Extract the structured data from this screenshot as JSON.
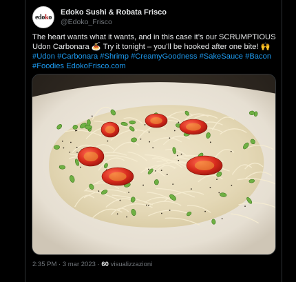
{
  "author": {
    "display_name": "Edoko Sushi & Robata Frisco",
    "handle": "@Edoko_Frisco",
    "avatar_logo_text": "edoko"
  },
  "tweet": {
    "line1": "The heart wants what it wants, and in this case it’s our SCRUMPTIOUS",
    "line2": "Udon Carbonara 🍝 Try it tonight – you’ll be hooked after one bite! 🙌",
    "hashtags_line1": [
      "#Udon",
      "#Carbonara",
      "#Shrimp",
      "#CreamyGoodness",
      "#SakeSauce",
      "#Bacon"
    ],
    "hashtags_line2": [
      "#Foodies"
    ],
    "link": "EdokoFrisco.com"
  },
  "media": {
    "description_icon": "pasta-dish-photo"
  },
  "meta": {
    "time": "2:35 PM",
    "separator": "·",
    "date": "3 mar 2023",
    "views_count": "60",
    "views_label": "visualizzazioni"
  },
  "colors": {
    "background": "#000000",
    "text": "#e7e9ea",
    "secondary": "#71767b",
    "link": "#1d9bf0",
    "border": "#2f3336"
  }
}
